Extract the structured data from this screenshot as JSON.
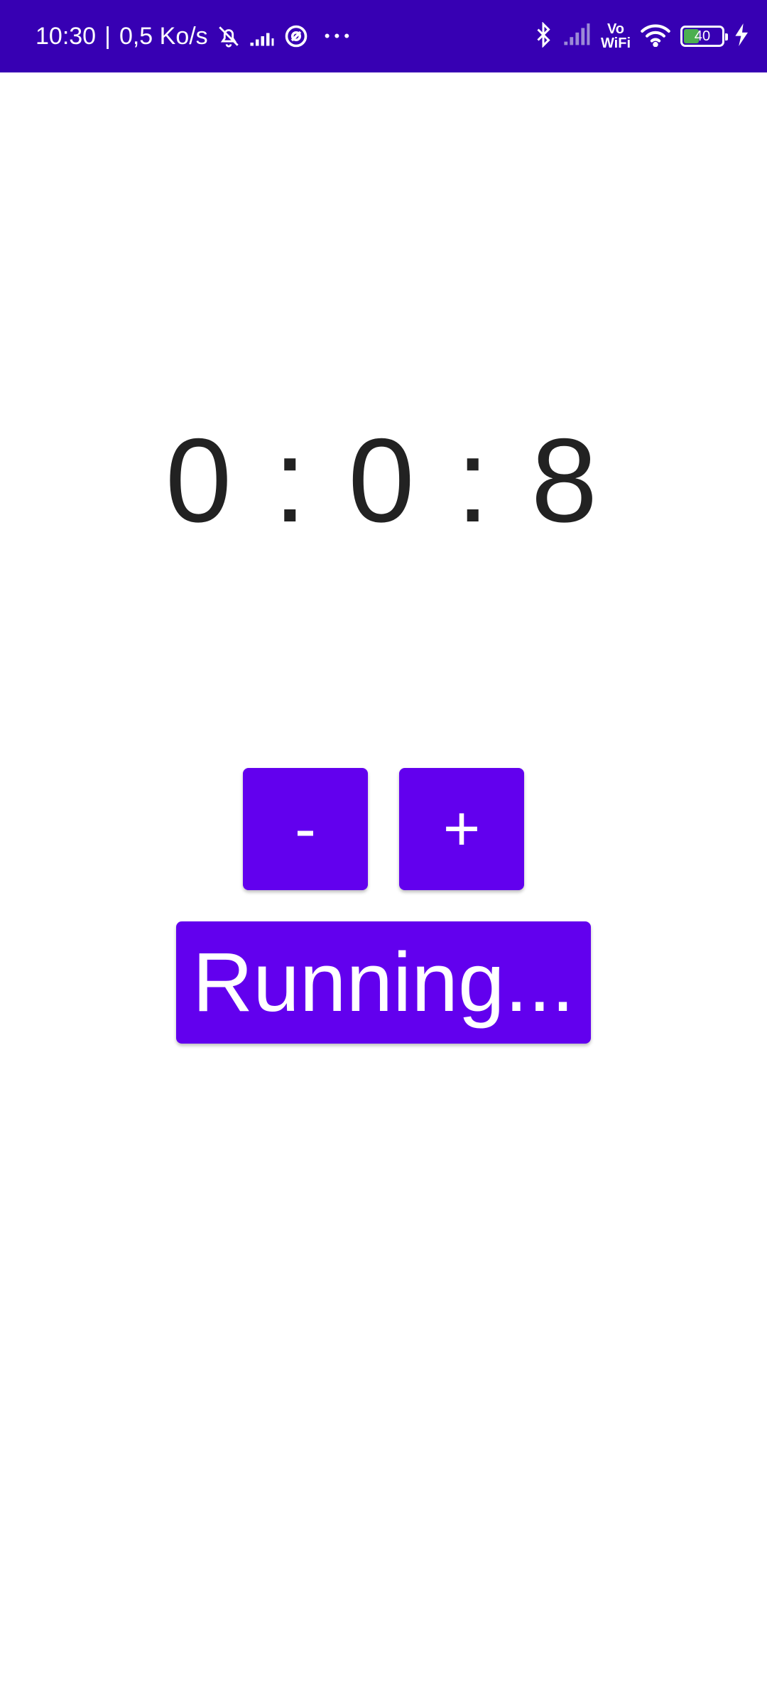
{
  "status_bar": {
    "time": "10:30",
    "separator": "|",
    "net_speed": "0,5 Ko/s",
    "overflow": "• • •",
    "vo": "Vo",
    "wifi": "WiFi",
    "battery_level": "40",
    "battery_fraction": 0.4,
    "battery_fill_color": "#4caf50",
    "background_color": "#3700b3"
  },
  "timer": {
    "display": "0 : 0 : 8"
  },
  "controls": {
    "minus_label": "-",
    "plus_label": "+",
    "running_label": "Running...",
    "button_color": "#6200ee"
  }
}
